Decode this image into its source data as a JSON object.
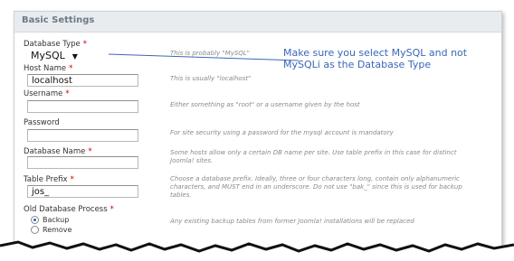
{
  "header": {
    "title": "Basic Settings"
  },
  "fields": {
    "db_type": {
      "label": "Database Type",
      "required": "*",
      "value": "MySQL",
      "hint": "This is probably \"MySQL\""
    },
    "host": {
      "label": "Host Name",
      "required": "*",
      "value": "localhost",
      "hint": "This is usually \"localhost\""
    },
    "username": {
      "label": "Username",
      "required": "*",
      "value": "",
      "hint": "Either something as \"root\" or a username given by the host"
    },
    "password": {
      "label": "Password",
      "value": "",
      "hint": "For site security using a password for the mysql account is mandatory"
    },
    "db_name": {
      "label": "Database Name",
      "required": "*",
      "value": "",
      "hint": "Some hosts allow only a certain DB name per site. Use table prefix in this case for distinct Joomla! sites."
    },
    "prefix": {
      "label": "Table Prefix",
      "required": "*",
      "value": "jos_",
      "hint": "Choose a database prefix. Ideally, three or four characters long, contain only alphanumeric characters, and MUST end in an underscore. Do not use \"bak_\" since this is used for backup tables."
    },
    "old_db": {
      "label": "Old Database Process",
      "required": "*",
      "options": [
        "Backup",
        "Remove"
      ],
      "selected": "Backup",
      "hint": "Any existing backup tables from former Joomla! installations will be replaced"
    }
  },
  "callout": {
    "line1": "Make sure you select MySQL and not",
    "line2": "MySQLi as the Database Type"
  },
  "colors": {
    "callout": "#3a67b8",
    "required": "#cc0000",
    "header_bg": "#e9ecef"
  }
}
